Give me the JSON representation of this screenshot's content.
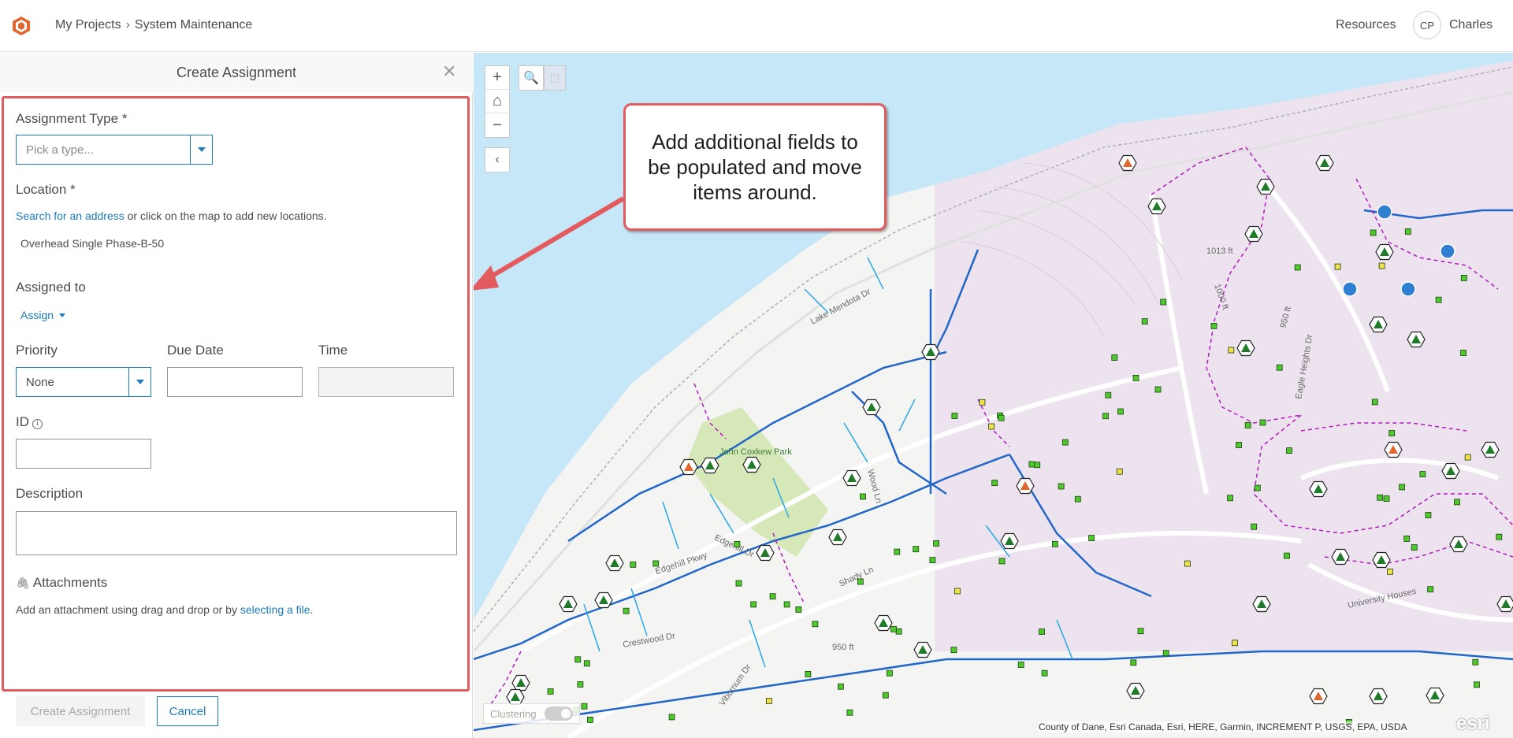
{
  "header": {
    "breadcrumbs": [
      "My Projects",
      "System Maintenance"
    ],
    "separator": "›",
    "resources": "Resources",
    "user": {
      "initials": "CP",
      "name": "Charles"
    }
  },
  "panel": {
    "title": "Create Assignment",
    "assignment_type": {
      "label": "Assignment Type *",
      "placeholder": "Pick a type..."
    },
    "location": {
      "label": "Location *",
      "search_link": "Search for an address",
      "hint": " or click on the map to add new locations.",
      "value": "Overhead Single Phase-B-50"
    },
    "assigned_to": {
      "label": "Assigned to",
      "action": "Assign"
    },
    "priority": {
      "label": "Priority",
      "value": "None"
    },
    "due_date": {
      "label": "Due Date",
      "value": ""
    },
    "time": {
      "label": "Time",
      "value": ""
    },
    "id_field": {
      "label": "ID",
      "value": ""
    },
    "description": {
      "label": "Description",
      "value": ""
    },
    "attachments": {
      "label": "Attachments",
      "hint": "Add an attachment using drag and drop or by ",
      "link": "selecting a file",
      "hint_end": "."
    },
    "buttons": {
      "create": "Create Assignment",
      "cancel": "Cancel"
    }
  },
  "map": {
    "callout": "Add additional fields to be populated and move items around.",
    "clustering": "Clustering",
    "attribution": "County of Dane, Esri Canada, Esri, HERE, Garmin, INCREMENT P, USGS, EPA, USDA",
    "esri": "esri",
    "street_labels": [
      "Lake Mendota Dr",
      "Edgehill Dr",
      "Edgehill Pkwy",
      "Crestwood Dr",
      "Shady Ln",
      "Wood Ln",
      "Viburnum Dr",
      "Eagle Heights Dr",
      "University Houses",
      "John Coxkew Park",
      "1013 ft",
      "1000 ft",
      "950 ft",
      "950 ft"
    ],
    "colors": {
      "water": "#c6e7f8",
      "park": "#d6e8b8",
      "campus": "#ece3ee",
      "line_primary": "#2166c9",
      "line_secondary": "#26a8e6",
      "line_service": "#b31ac0",
      "meter": "#4ec92c",
      "callout_border": "#e25b5f"
    },
    "tools": [
      "zoom-in",
      "home",
      "zoom-out",
      "search",
      "select",
      "collapse"
    ]
  }
}
